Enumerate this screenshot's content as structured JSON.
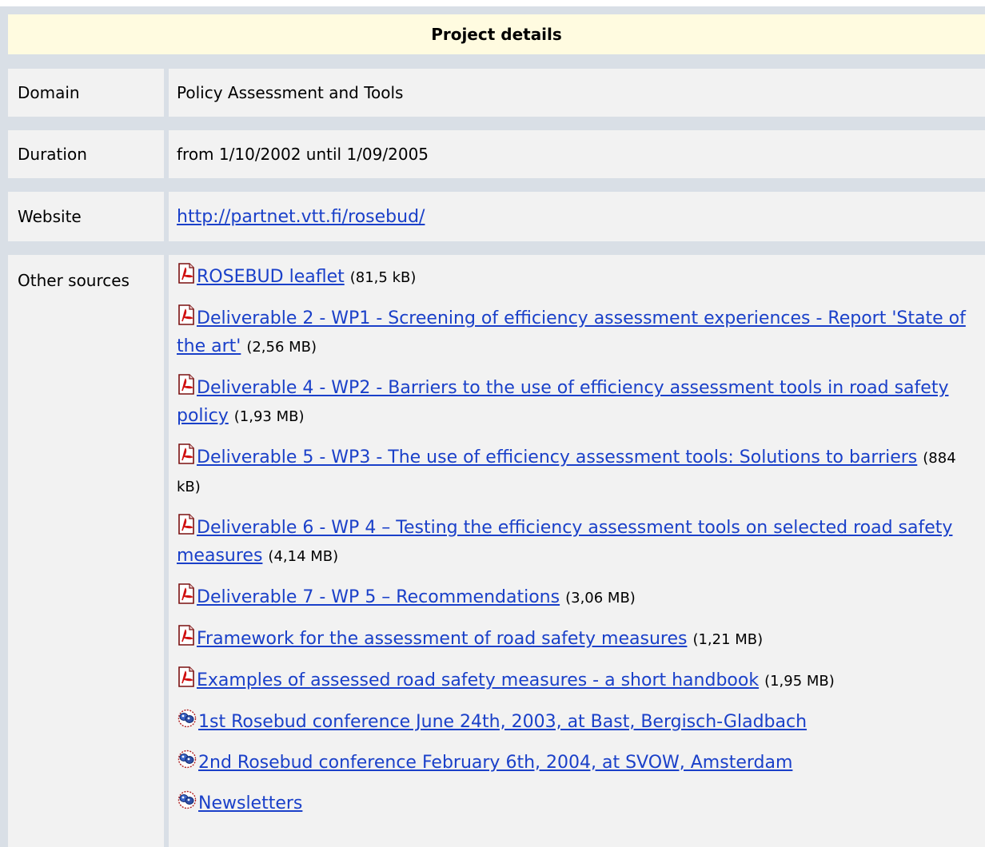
{
  "header": {
    "title": "Project details"
  },
  "rows": {
    "domain": {
      "label": "Domain",
      "value": "Policy Assessment and Tools"
    },
    "duration": {
      "label": "Duration",
      "value": "from 1/10/2002 until 1/09/2005"
    },
    "website": {
      "label": "Website",
      "link": "http://partnet.vtt.fi/rosebud/"
    },
    "sources": {
      "label": "Other sources",
      "items": [
        {
          "icon": "pdf-icon",
          "link": "ROSEBUD leaflet",
          "size": "(81,5 kB)"
        },
        {
          "icon": "pdf-icon",
          "link": "Deliverable 2 - WP1 - Screening of efficiency assessment experiences - Report 'State of the art'",
          "size": "(2,56 MB)"
        },
        {
          "icon": "pdf-icon",
          "link": "Deliverable 4 - WP2 - Barriers to the use of efficiency assessment tools in road safety policy",
          "size": "(1,93 MB)"
        },
        {
          "icon": "pdf-icon",
          "link": "Deliverable 5 - WP3 - The use of efficiency assessment tools: Solutions to barriers",
          "size": "(884 kB)"
        },
        {
          "icon": "pdf-icon",
          "link": "Deliverable 6 - WP 4 – Testing the efficiency assessment tools on selected road safety measures",
          "size": "(4,14 MB)"
        },
        {
          "icon": "pdf-icon",
          "link": "Deliverable 7 - WP 5 – Recommendations",
          "size": "(3,06 MB)"
        },
        {
          "icon": "pdf-icon",
          "link": "Framework for the assessment of road safety measures",
          "size": "(1,21 MB)"
        },
        {
          "icon": "pdf-icon",
          "link": "Examples of assessed road safety measures - a short handbook",
          "size": "(1,95 MB)"
        },
        {
          "icon": "web-link-icon",
          "link": "1st Rosebud conference June 24th, 2003, at Bast, Bergisch-Gladbach",
          "size": ""
        },
        {
          "icon": "web-link-icon",
          "link": "2nd Rosebud conference February 6th, 2004, at SVOW, Amsterdam",
          "size": ""
        },
        {
          "icon": "web-link-icon",
          "link": "Newsletters",
          "size": ""
        }
      ]
    }
  },
  "colors": {
    "frame": "#d9dfe6",
    "cell": "#f2f2f2",
    "header": "#fffbe0",
    "link": "#1a40c9"
  }
}
